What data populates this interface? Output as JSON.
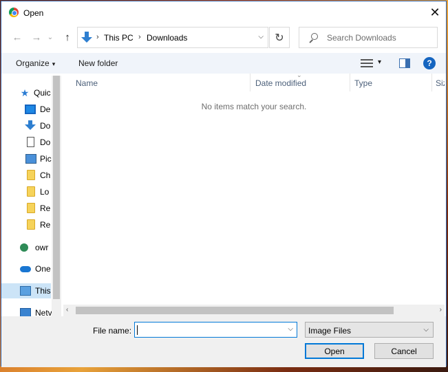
{
  "window": {
    "title": "Open",
    "close_glyph": "✕"
  },
  "nav": {
    "back": "←",
    "forward": "→",
    "recent": "⌄",
    "up": "↑"
  },
  "address": {
    "crumbs": [
      "This PC",
      "Downloads"
    ],
    "separator": "›",
    "dropdown": "⌵",
    "refresh": "↻"
  },
  "search": {
    "placeholder": "Search Downloads"
  },
  "toolbar": {
    "organize": "Organize",
    "organize_arrow": "▾",
    "new_folder": "New folder",
    "view_arrow": "▾",
    "help": "?"
  },
  "sidebar": {
    "items": [
      {
        "label": "Quic",
        "icon": "star-icon"
      },
      {
        "label": "De",
        "icon": "desktop-icon"
      },
      {
        "label": "Do",
        "icon": "download-icon"
      },
      {
        "label": "Do",
        "icon": "document-icon"
      },
      {
        "label": "Pic",
        "icon": "pictures-icon"
      },
      {
        "label": "Ch",
        "icon": "folder-icon"
      },
      {
        "label": "Lo",
        "icon": "folder-icon"
      },
      {
        "label": "Re",
        "icon": "folder-icon"
      },
      {
        "label": "Re",
        "icon": "folder-icon"
      },
      {
        "label": "owr",
        "icon": "user-sync-icon"
      },
      {
        "label": "One",
        "icon": "onedrive-icon"
      },
      {
        "label": "This",
        "icon": "this-pc-icon",
        "selected": true
      },
      {
        "label": "Netv",
        "icon": "network-icon"
      }
    ]
  },
  "columns": {
    "name": "Name",
    "date_modified": "Date modified",
    "type": "Type",
    "size": "Size"
  },
  "content": {
    "empty_message": "No items match your search."
  },
  "hscroll": {
    "left": "‹",
    "right": "›"
  },
  "footer": {
    "file_name_label": "File name:",
    "file_name_value": "",
    "file_type": "Image Files",
    "dropdown": "⌵",
    "open_label": "Open",
    "cancel_label": "Cancel"
  }
}
